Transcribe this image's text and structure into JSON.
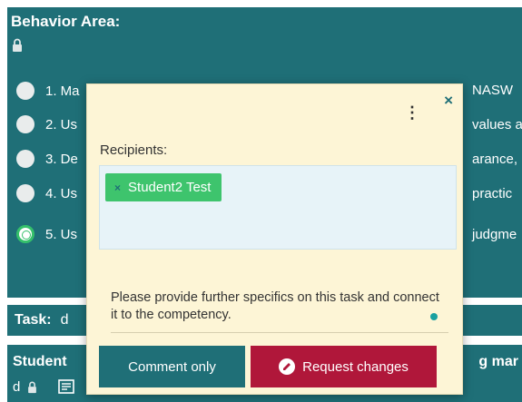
{
  "background": {
    "title": "Behavior Area:",
    "options": [
      {
        "left": "1. Ma",
        "right": "NASW"
      },
      {
        "left": "2. Us",
        "right": "values a"
      },
      {
        "left": "3. De",
        "right": "arance,"
      },
      {
        "left": "4. Us",
        "right": "practic"
      },
      {
        "left": "5. Us",
        "right": "judgme"
      }
    ],
    "task_label": "Task:",
    "task_value": "d",
    "student_label": "Student",
    "student_d": "d",
    "mgmt_text": "g mar"
  },
  "popup": {
    "close_label": "×",
    "menu_label": "⋮",
    "recipients_label": "Recipients:",
    "recipient_chip": "Student2 Test",
    "chip_remove": "×",
    "message": "Please provide further specifics on this task and connect it to the competency.",
    "comment_button": "Comment only",
    "request_button": "Request changes"
  },
  "colors": {
    "teal": "#1f6f77",
    "green": "#3ec46d",
    "crimson": "#b0173a",
    "popup_bg": "#fdf5d6"
  }
}
